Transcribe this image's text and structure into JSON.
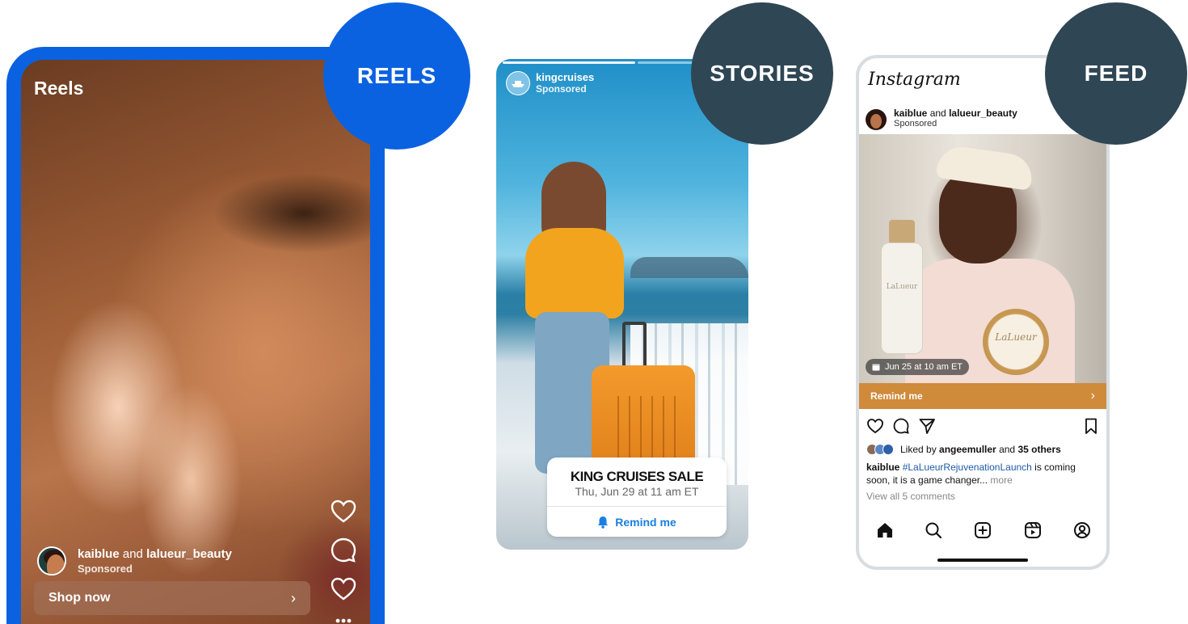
{
  "reels": {
    "title": "Reels",
    "account_primary": "kaiblue",
    "account_joiner": " and ",
    "account_secondary": "lalueur_beauty",
    "sponsored": "Sponsored",
    "cta": "Shop now",
    "cta_chevron": "›",
    "icons": [
      "heart-icon",
      "comment-icon",
      "heart-icon",
      "more-icon"
    ],
    "label": "REELS"
  },
  "stories": {
    "account": "kingcruises",
    "sponsored": "Sponsored",
    "event_title": "KING CRUISES SALE",
    "event_date": "Thu, Jun 29 at 11 am ET",
    "remind": "Remind me",
    "label": "STORIES"
  },
  "feed": {
    "logo": "Instagram",
    "account_primary": "kaiblue",
    "account_joiner": " and ",
    "account_secondary": "lalueur_beauty",
    "sponsored": "Sponsored",
    "product_name": "LaLueur",
    "event_badge": "Jun 25 at 10 am ET",
    "remind": "Remind me",
    "remind_chevron": "›",
    "liked_prefix": "Liked by ",
    "liked_user": "angeemuller",
    "liked_mid": " and ",
    "liked_count": "35 others",
    "caption_user": "kaiblue",
    "caption_hashtag": "#LaLueurRejuvenationLaunch",
    "caption_text": " is coming soon, it is a game changer...",
    "caption_more": " more",
    "comments": "View all 5 comments",
    "label": "FEED"
  },
  "colors": {
    "reels_accent": "#0b62e0",
    "label_dark": "#2f4654",
    "remind_bar": "#cf8a3a",
    "link_blue": "#1a7fe0"
  }
}
